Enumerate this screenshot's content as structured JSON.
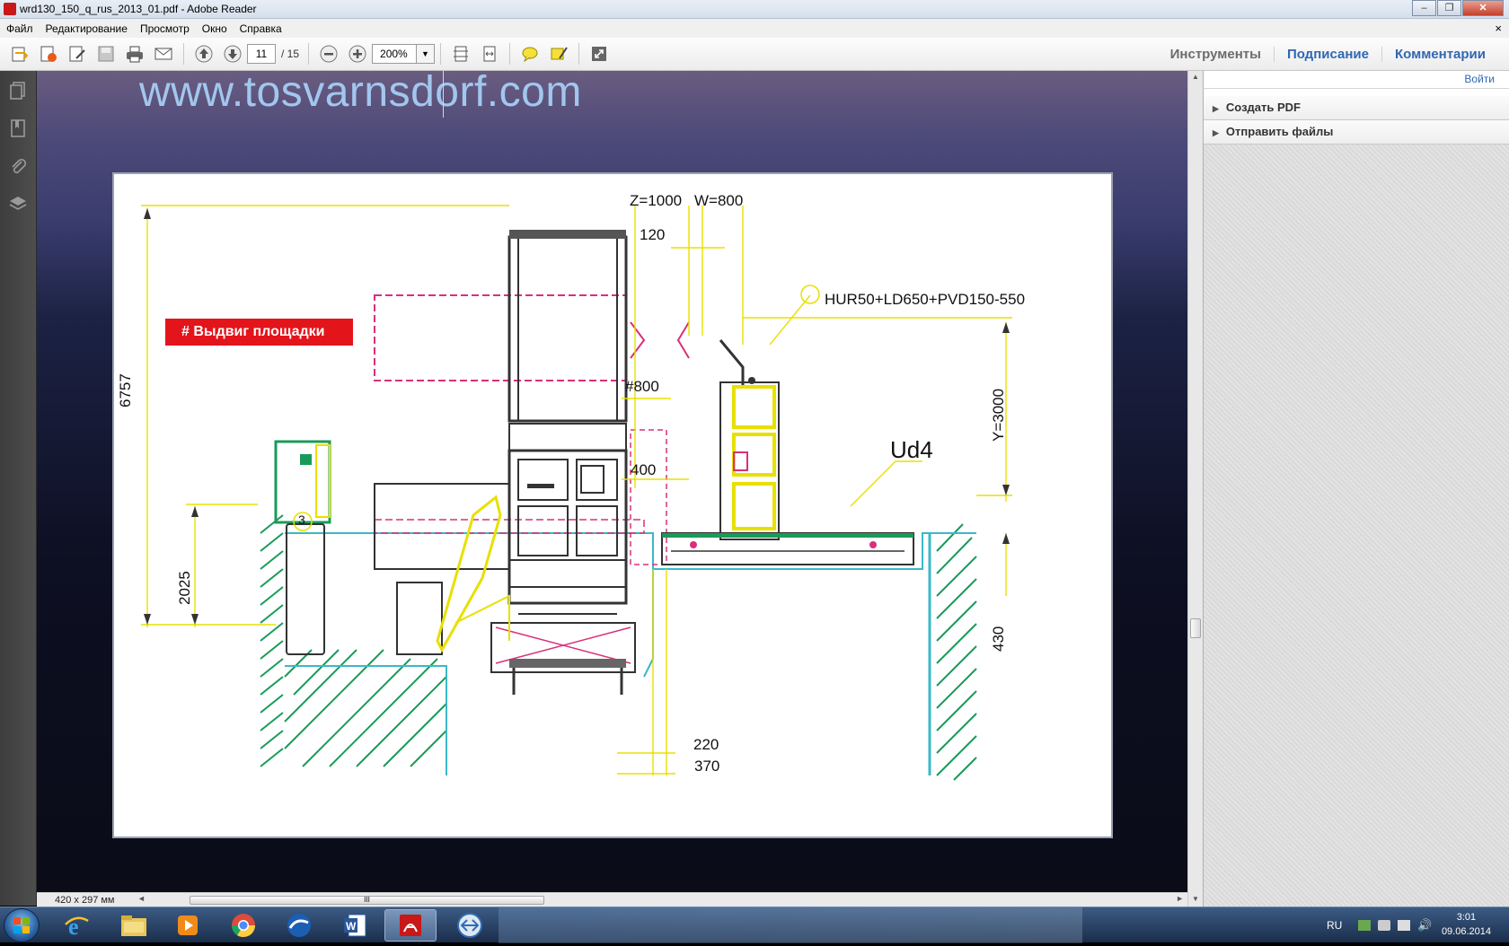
{
  "window": {
    "title": "wrd130_150_q_rus_2013_01.pdf - Adobe Reader",
    "controls": [
      "–",
      "❐",
      "✕"
    ]
  },
  "menu": {
    "items": [
      "Файл",
      "Редактирование",
      "Просмотр",
      "Окно",
      "Справка"
    ],
    "close": "×"
  },
  "toolbar": {
    "page_current": "11",
    "page_total": "/ 15",
    "zoom": "200%",
    "links": [
      "Инструменты",
      "Подписание",
      "Комментарии"
    ]
  },
  "right_panel": {
    "login": "Войти",
    "sections": [
      "Создать PDF",
      "Отправить файлы"
    ]
  },
  "document": {
    "header_url": "www.tosvarnsdorf.com",
    "drawing": {
      "label_badge": "#  Выдвиг площадки",
      "dims": {
        "z": "Z=1000",
        "w": "W=800",
        "d120": "120",
        "head": "HUR50+LD650+PVD150-550",
        "h6757": "6757",
        "y3000": "Y=3000",
        "d800": "#800",
        "d400": "400",
        "ud4": "Ud4",
        "h2025": "2025",
        "h430": "430",
        "circ3": "3",
        "d220": "220",
        "d370": "370"
      }
    }
  },
  "status": {
    "page_size": "420 x 297 мм",
    "scroll_thumb": "III"
  },
  "taskbar": {
    "apps": [
      "internet-explorer",
      "file-explorer",
      "media-player",
      "chrome",
      "app-blue",
      "word",
      "adobe-reader",
      "app-teamviewer"
    ],
    "lang": "RU",
    "time": "3:01",
    "date": "09.06.2014"
  },
  "colors": {
    "accent_red": "#e4141b",
    "link_blue": "#3067b3",
    "url_blue": "#a2c7ee",
    "dim_yellow": "#e8e000",
    "cyan": "#3ab8c8",
    "green": "#1a9a5a",
    "magenta": "#d8307a"
  }
}
